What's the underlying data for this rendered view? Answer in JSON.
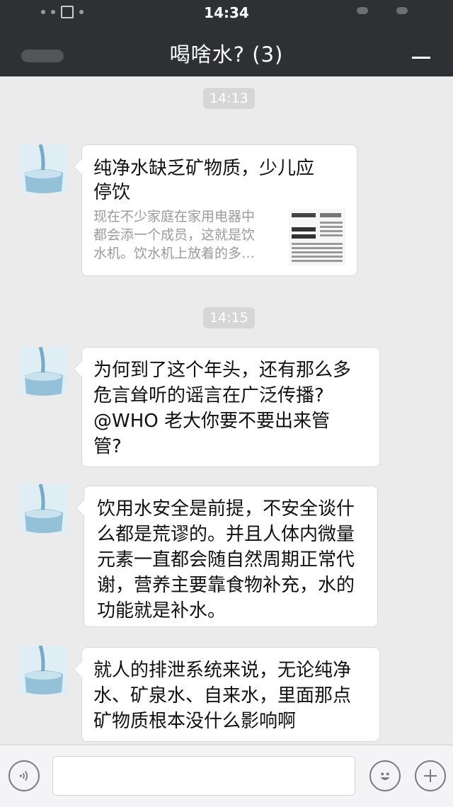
{
  "status": {
    "time": "14:34"
  },
  "header": {
    "title": "喝啥水? (3)"
  },
  "messages": [
    {
      "time": "14:13"
    },
    {
      "type": "link-card",
      "title": "纯净水缺乏矿物质，少儿应停饮",
      "title_line1": "纯净水缺乏矿物质，少儿应",
      "title_line2": "停饮",
      "desc_line1": "现在不少家庭在家用电器中",
      "desc_line2": "都会添一个成员，这就是饮",
      "desc_line3": "水机。饮水机上放着的多…",
      "thumb_icon": "newspaper-thumbnail"
    },
    {
      "time": "14:15"
    },
    {
      "type": "text",
      "lines": [
        "为何到了这个年头，还有那么多",
        "危言耸听的谣言在广泛传播?",
        "@WHO 老大你要不要出来管",
        "管?"
      ]
    },
    {
      "type": "text",
      "lines": [
        "饮用水安全是前提，不安全谈什",
        "么都是荒谬的。并且人体内微量",
        "元素一直都会随自然周期正常代",
        "谢，营养主要靠食物补充，水的",
        "功能就是补水。"
      ]
    },
    {
      "type": "text",
      "lines": [
        "就人的排泄系统来说，无论纯净",
        "水、矿泉水、自来水，里面那点",
        "矿物质根本没什么影响啊"
      ]
    }
  ],
  "inputbar": {
    "voice_icon": "voice-icon",
    "emoji_icon": "emoji-icon",
    "plus_icon": "plus-icon"
  },
  "colors": {
    "titlebar": "#2f3034",
    "chat_bg": "#ebebeb",
    "bubble": "#ffffff",
    "time_chip": "#d6d6d6"
  }
}
